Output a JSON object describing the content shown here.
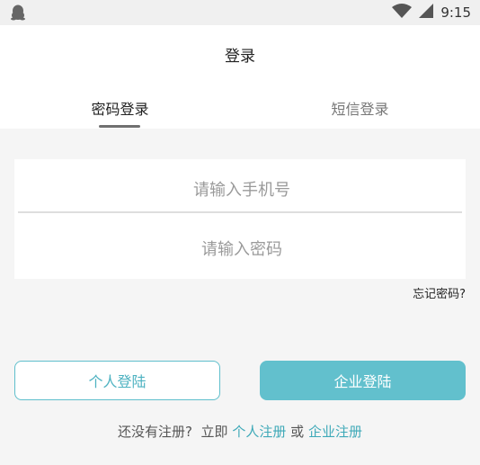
{
  "status_bar": {
    "time": "9:15",
    "left_icon": "qq-penguin-icon",
    "right_icons": [
      "wifi-icon",
      "signal-icon"
    ]
  },
  "header": {
    "title": "登录",
    "tabs": [
      {
        "label": "密码登录",
        "active": true
      },
      {
        "label": "短信登录",
        "active": false
      }
    ]
  },
  "form": {
    "phone_placeholder": "请输入手机号",
    "password_placeholder": "请输入密码",
    "forgot_label": "忘记密码?"
  },
  "buttons": {
    "personal_login": "个人登陆",
    "enterprise_login": "企业登陆"
  },
  "register": {
    "prefix": "还没有注册?",
    "now": "立即",
    "personal_link": "个人注册",
    "or": "或",
    "enterprise_link": "企业注册"
  },
  "colors": {
    "accent": "#62c0cd",
    "link": "#3ea9b8",
    "background": "#f5f5f5"
  }
}
